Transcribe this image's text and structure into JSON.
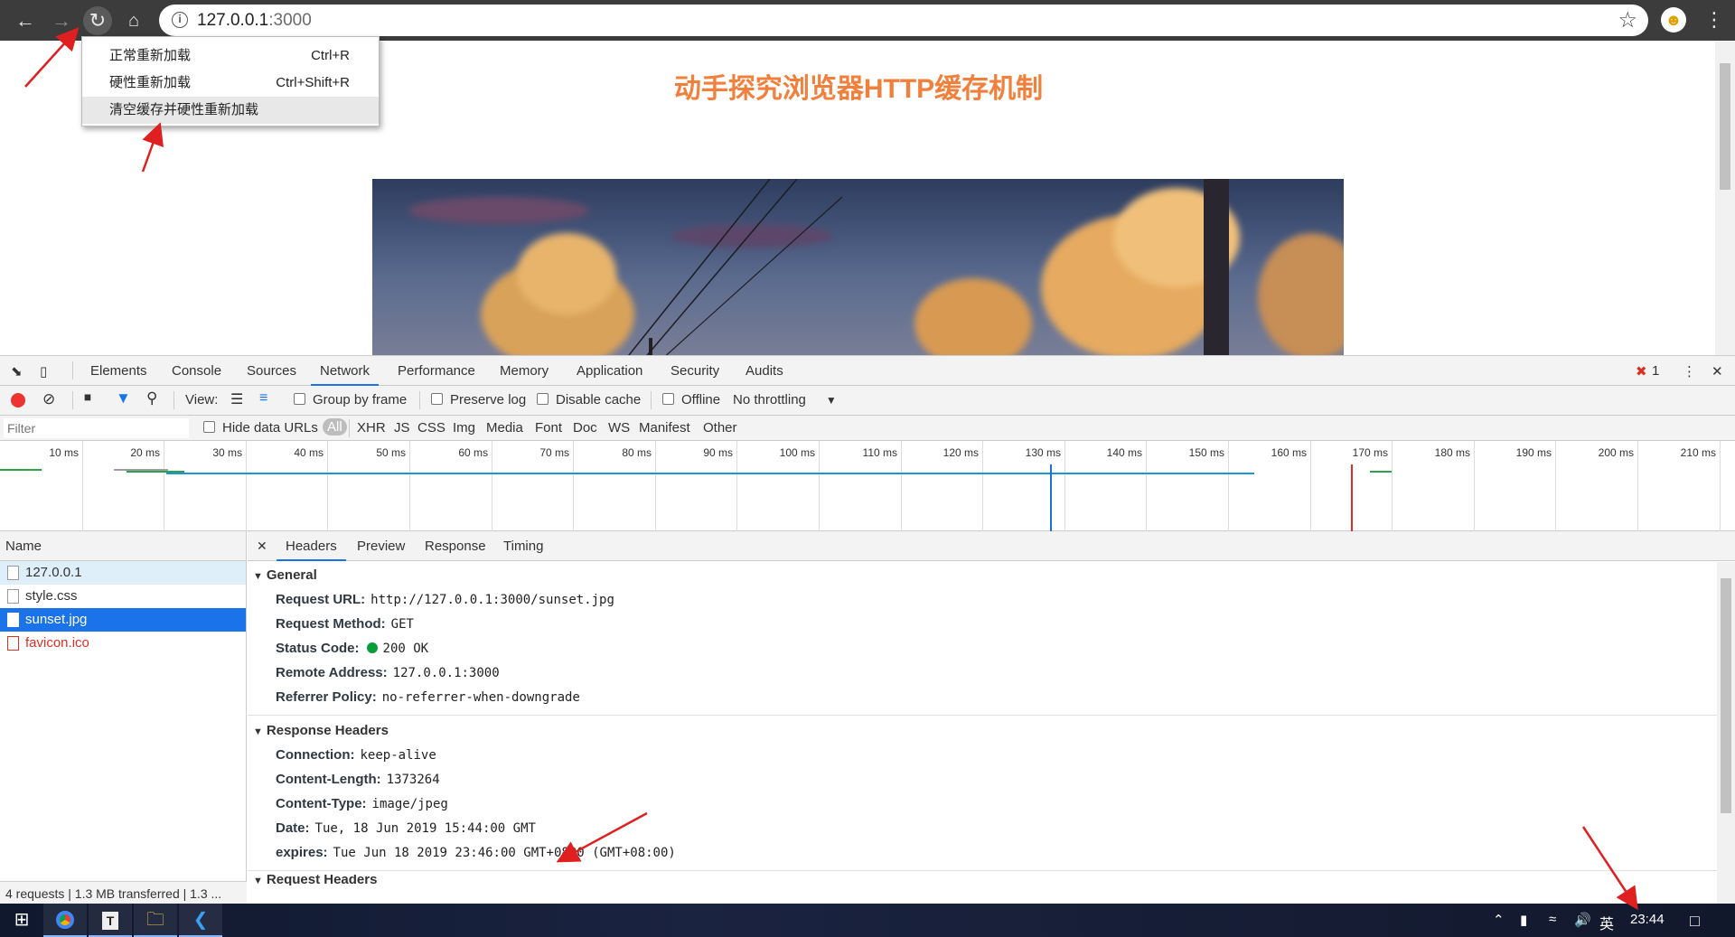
{
  "browser": {
    "url_host": "127.0.0.1",
    "url_port": ":3000",
    "reload_menu": [
      {
        "label": "正常重新加载",
        "shortcut": "Ctrl+R"
      },
      {
        "label": "硬性重新加载",
        "shortcut": "Ctrl+Shift+R"
      },
      {
        "label": "清空缓存并硬性重新加载",
        "shortcut": ""
      }
    ]
  },
  "page": {
    "heading": "动手探究浏览器HTTP缓存机制"
  },
  "devtools": {
    "tabs": [
      "Elements",
      "Console",
      "Sources",
      "Network",
      "Performance",
      "Memory",
      "Application",
      "Security",
      "Audits"
    ],
    "active_tab": "Network",
    "error_count": "1",
    "toolbar": {
      "view_label": "View:",
      "group_by_frame": "Group by frame",
      "preserve_log": "Preserve log",
      "disable_cache": "Disable cache",
      "offline": "Offline",
      "throttling": "No throttling"
    },
    "filter": {
      "placeholder": "Filter",
      "hide_data_urls": "Hide data URLs",
      "types": [
        "All",
        "XHR",
        "JS",
        "CSS",
        "Img",
        "Media",
        "Font",
        "Doc",
        "WS",
        "Manifest",
        "Other"
      ]
    },
    "timeline_ticks": [
      "10 ms",
      "20 ms",
      "30 ms",
      "40 ms",
      "50 ms",
      "60 ms",
      "70 ms",
      "80 ms",
      "90 ms",
      "100 ms",
      "110 ms",
      "120 ms",
      "130 ms",
      "140 ms",
      "150 ms",
      "160 ms",
      "170 ms",
      "180 ms",
      "190 ms",
      "200 ms",
      "210 ms"
    ],
    "name_header": "Name",
    "requests": [
      {
        "name": "127.0.0.1",
        "state": "hover"
      },
      {
        "name": "style.css",
        "state": ""
      },
      {
        "name": "sunset.jpg",
        "state": "selected"
      },
      {
        "name": "favicon.ico",
        "state": "error"
      }
    ],
    "status_bar": "4 requests  |  1.3 MB transferred  |  1.3 ...",
    "detail_tabs": [
      "Headers",
      "Preview",
      "Response",
      "Timing"
    ],
    "general_title": "General",
    "general": [
      {
        "k": "Request URL:",
        "v": "http://127.0.0.1:3000/sunset.jpg"
      },
      {
        "k": "Request Method:",
        "v": "GET"
      },
      {
        "k": "Status Code:",
        "v": "200 OK"
      },
      {
        "k": "Remote Address:",
        "v": "127.0.0.1:3000"
      },
      {
        "k": "Referrer Policy:",
        "v": "no-referrer-when-downgrade"
      }
    ],
    "response_title": "Response Headers",
    "response": [
      {
        "k": "Connection:",
        "v": "keep-alive"
      },
      {
        "k": "Content-Length:",
        "v": "1373264"
      },
      {
        "k": "Content-Type:",
        "v": "image/jpeg"
      },
      {
        "k": "Date:",
        "v": "Tue, 18 Jun 2019 15:44:00 GMT"
      },
      {
        "k": "expires:",
        "v": "Tue Jun 18 2019 23:46:00 GMT+0800 (GMT+08:00)"
      }
    ],
    "request_title_partial": "Request Headers"
  },
  "taskbar": {
    "ime": "英",
    "clock": "23:44"
  },
  "colors": {
    "heading": "#f0803c",
    "selection": "#1a73e8",
    "arrow": "#e02020"
  }
}
